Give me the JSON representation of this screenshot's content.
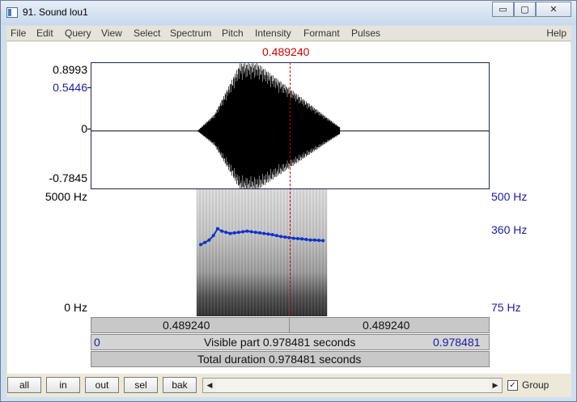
{
  "window": {
    "title": "91. Sound lou1",
    "controls": {
      "minimize": "▭",
      "maximize": "▢",
      "close": "✕"
    }
  },
  "menu": {
    "items": [
      "File",
      "Edit",
      "Query",
      "View",
      "Select",
      "Spectrum",
      "Pitch",
      "Intensity",
      "Formant",
      "Pulses"
    ],
    "help": "Help"
  },
  "cursor": {
    "time": "0.489240",
    "time_seconds": 0.48924,
    "visible_duration": 0.978481
  },
  "waveform": {
    "y_max": "0.8993",
    "y_cursor": "0.5446",
    "y_zero": "0",
    "y_min": "-0.7845",
    "range": [
      -0.7845,
      0.8993
    ]
  },
  "spectrogram": {
    "freq_max": "5000 Hz",
    "freq_min": "0 Hz",
    "pitch_max": "500 Hz",
    "pitch_cursor": "360 Hz",
    "pitch_min": "75 Hz",
    "pitch_contour_hz": [
      315,
      322,
      330,
      345,
      368,
      360,
      356,
      352,
      354,
      356,
      358,
      360,
      358,
      356,
      354,
      352,
      350,
      348,
      345,
      342,
      340,
      338,
      336,
      335,
      334,
      332,
      330,
      330,
      329,
      328
    ]
  },
  "bars": {
    "left_time": "0.489240",
    "right_time": "0.489240",
    "visible_start": "0",
    "visible_label": "Visible part 0.978481 seconds",
    "visible_end": "0.978481",
    "total_label": "Total duration 0.978481 seconds"
  },
  "buttons": {
    "all": "all",
    "in": "in",
    "out": "out",
    "sel": "sel",
    "bak": "bak"
  },
  "group": {
    "label": "Group",
    "checked": true,
    "mark": "✓"
  },
  "scroll": {
    "left_arrow": "◀",
    "right_arrow": "▶"
  },
  "colors": {
    "cursor": "#d00000",
    "axis_blue": "#1a1aa6",
    "pitch": "#1030d0"
  }
}
